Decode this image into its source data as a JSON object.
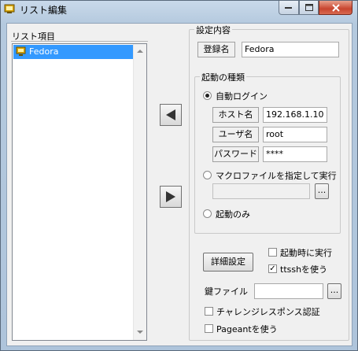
{
  "window": {
    "title": "リスト編集"
  },
  "list": {
    "header": "リスト項目",
    "items": [
      {
        "label": "Fedora",
        "selected": true
      }
    ]
  },
  "settings": {
    "legend": "設定内容",
    "registered_name_label": "登録名",
    "registered_name_value": "Fedora",
    "launch_type": {
      "legend": "起動の種類",
      "auto_login": {
        "label": "自動ログイン",
        "selected": true
      },
      "host_label": "ホスト名",
      "host_value": "192.168.1.10",
      "user_label": "ユーザ名",
      "user_value": "root",
      "password_label": "パスワード",
      "password_value": "****",
      "macro": {
        "label": "マクロファイルを指定して実行",
        "selected": false
      },
      "macro_path": "",
      "browse_label": "...",
      "launch_only": {
        "label": "起動のみ",
        "selected": false
      }
    },
    "detail_button": "詳細設定",
    "run_at_startup": {
      "label": "起動時に実行",
      "checked": false
    },
    "use_ttssh": {
      "label": "ttsshを使う",
      "checked": true
    },
    "key_file_label": "鍵ファイル",
    "key_file_value": "",
    "key_browse_label": "...",
    "challenge_response": {
      "label": "チャレンジレスポンス認証",
      "checked": false
    },
    "use_pageant": {
      "label": "Pageantを使う",
      "checked": false
    }
  },
  "icons": {
    "app": "app-icon",
    "list_item": "computer-icon",
    "move_left": "left-arrow-icon",
    "move_right": "right-arrow-icon"
  },
  "colors": {
    "selection": "#3399ff",
    "close_button": "#c8452f"
  }
}
